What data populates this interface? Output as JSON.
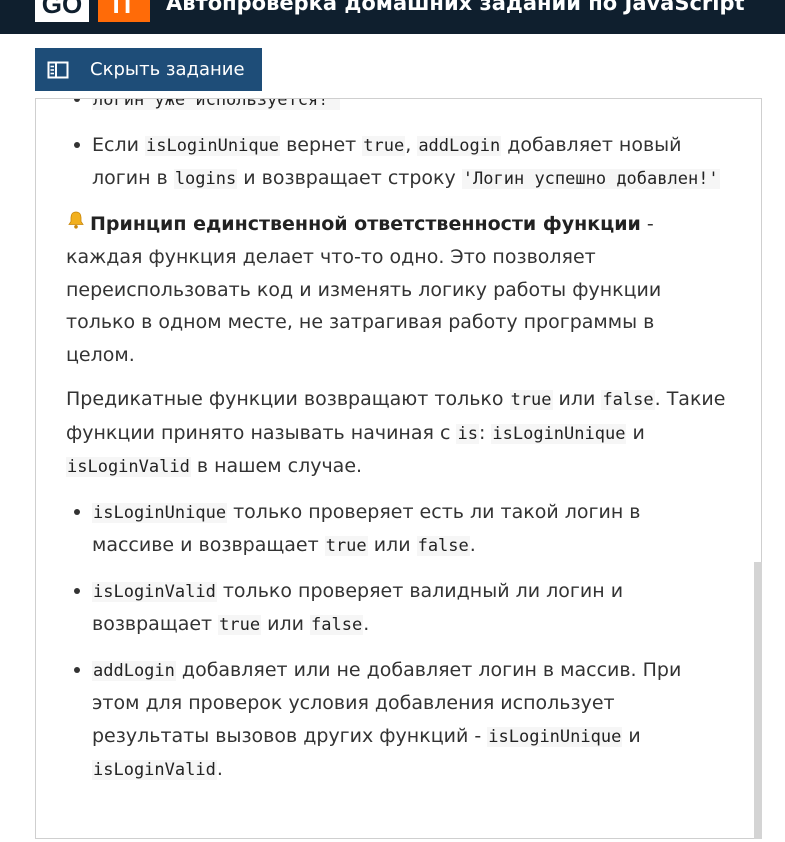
{
  "header": {
    "logo_left": "GO",
    "logo_right": "IT",
    "title": "Автопроверка домашних заданий по JavaScript"
  },
  "hide_button": {
    "label": "Скрыть задание",
    "icon": "book-open-icon"
  },
  "content": {
    "top_cut_code": "логин уже используется!'",
    "bullet1": {
      "t1": "Если ",
      "c1": "isLoginUnique",
      "t2": " вернет ",
      "c2": "true",
      "t3": ", ",
      "c3": "addLogin",
      "t4": " добавляет новый логин в ",
      "c4": "logins",
      "t5": " и возвращает строку ",
      "c5": "'Логин успешно добавлен!'"
    },
    "principle": {
      "icon": "bell-icon",
      "bold": "Принцип единственной ответственности функции",
      "text": " - каждая функция делает что-то одно. Это позволяет переиспользовать код и изменять логику работы функции только в одном месте, не затрагивая работу программы в целом."
    },
    "predicate": {
      "t1": "Предикатные функции возвращают только ",
      "c1": "true",
      "t2": " или ",
      "c2": "false",
      "t3": ". Такие функции принято называть начиная с ",
      "c3": "is",
      "t4": ": ",
      "c4": "isLoginUnique",
      "t5": " и ",
      "c5": "isLoginValid",
      "t6": " в нашем случае."
    },
    "list": [
      {
        "c1": "isLoginUnique",
        "t1": " только проверяет есть ли такой логин в массиве и возвращает ",
        "c2": "true",
        "t2": " или ",
        "c3": "false",
        "t3": "."
      },
      {
        "c1": "isLoginValid",
        "t1": " только проверяет валидный ли логин и возвращает ",
        "c2": "true",
        "t2": " или ",
        "c3": "false",
        "t3": "."
      },
      {
        "c1": "addLogin",
        "t1": " добавляет или не добавляет логин в массив. При этом для проверок условия добавления использует результаты вызовов других функций - ",
        "c2": "isLoginUnique",
        "t2": " и ",
        "c3": "isLoginValid",
        "t3": "."
      }
    ]
  }
}
